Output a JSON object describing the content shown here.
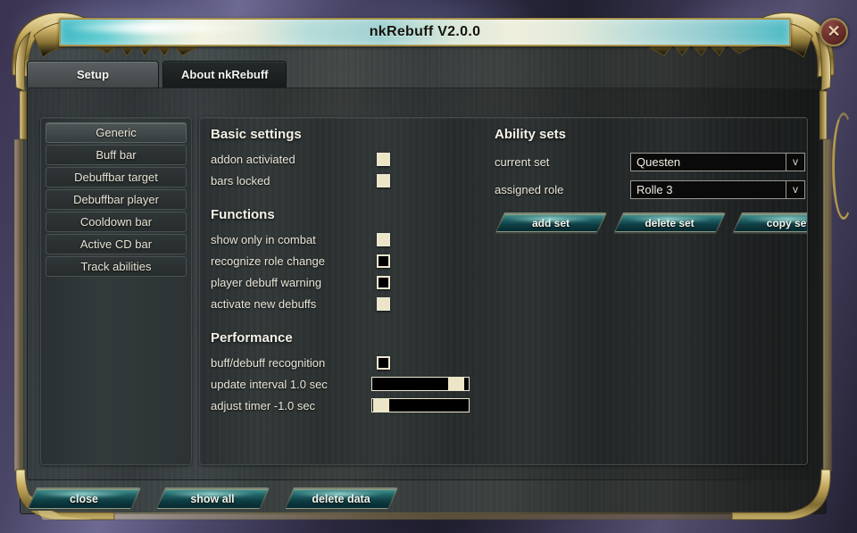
{
  "window": {
    "title": "nkRebuff V2.0.0",
    "close_label": "✕",
    "close_icon": "close-x-icon"
  },
  "tabs": [
    {
      "label": "Setup",
      "active": true
    },
    {
      "label": "About nkRebuff",
      "active": false
    }
  ],
  "sidebar": {
    "items": [
      {
        "label": "Generic",
        "selected": true
      },
      {
        "label": "Buff bar",
        "selected": false
      },
      {
        "label": "Debuffbar target",
        "selected": false
      },
      {
        "label": "Debuffbar player",
        "selected": false
      },
      {
        "label": "Cooldown bar",
        "selected": false
      },
      {
        "label": "Active CD bar",
        "selected": false
      },
      {
        "label": "Track abilities",
        "selected": false
      }
    ]
  },
  "settings": {
    "basic": {
      "heading": "Basic settings",
      "options": [
        {
          "label": "addon activiated",
          "checked": true
        },
        {
          "label": "bars locked",
          "checked": true
        }
      ]
    },
    "functions": {
      "heading": "Functions",
      "options": [
        {
          "label": "show only in combat",
          "checked": true
        },
        {
          "label": "recognize role change",
          "checked": false
        },
        {
          "label": "player debuff warning",
          "checked": false
        },
        {
          "label": "activate new debuffs",
          "checked": true
        }
      ]
    },
    "performance": {
      "heading": "Performance",
      "options": [
        {
          "label": "buff/debuff recognition",
          "checked": false
        }
      ],
      "sliders": [
        {
          "label": "update interval 1.0 sec",
          "value": 1.0,
          "percent": 92
        },
        {
          "label": "adjust timer -1.0 sec",
          "value": -1.0,
          "percent": 1
        }
      ]
    }
  },
  "ability_sets": {
    "heading": "Ability sets",
    "fields": [
      {
        "label": "current set",
        "value": "Questen",
        "chevron": "v"
      },
      {
        "label": "assigned role",
        "value": "Rolle 3",
        "chevron": "v"
      }
    ],
    "edit_icon": "pencil-icon",
    "buttons": [
      {
        "label": "add set"
      },
      {
        "label": "delete set"
      },
      {
        "label": "copy set"
      }
    ]
  },
  "footer": {
    "buttons": [
      {
        "label": "close"
      },
      {
        "label": "show all"
      },
      {
        "label": "delete data"
      }
    ]
  },
  "colors": {
    "title_gradient_start": "#3fb9c4",
    "title_gradient_end": "#4fbcc6",
    "frame_gold": "#a8924b",
    "checkbox_fill": "#ece5c6",
    "button_teal": "#1e5f63",
    "close_red": "#6d2f2c",
    "panel_dark": "#2b3132",
    "text_cream": "#e9e6d8"
  }
}
